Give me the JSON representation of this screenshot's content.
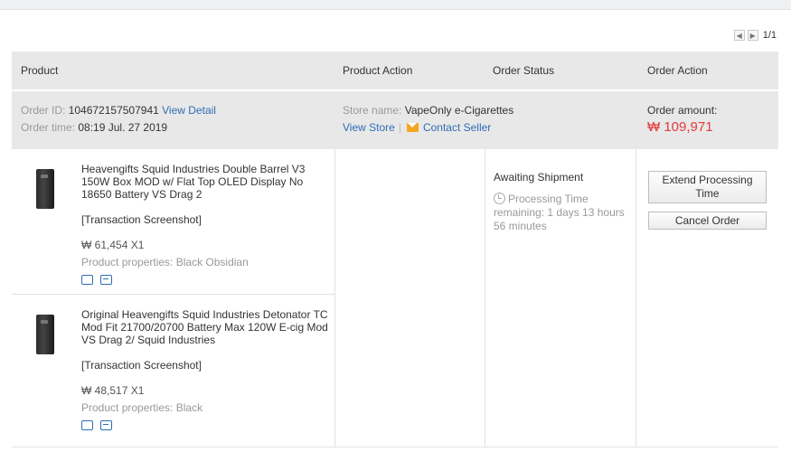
{
  "pagination": {
    "prev_icon": "chevron-left-icon",
    "next_icon": "chevron-right-icon",
    "text": "1/1"
  },
  "columns": {
    "product": "Product",
    "product_action": "Product Action",
    "order_status": "Order Status",
    "order_action": "Order Action"
  },
  "order": {
    "id_label": "Order ID:",
    "id_value": "104672157507941",
    "view_detail": "View Detail",
    "time_label": "Order time:",
    "time_value": "08:19 Jul. 27 2019",
    "store_label": "Store name:",
    "store_value": "VapeOnly e-Cigarettes",
    "view_store": "View Store",
    "separator": "|",
    "contact_seller": "Contact Seller",
    "amount_label": "Order amount:",
    "amount_value": "₩ 109,971",
    "status": "Awaiting Shipment",
    "processing_label": "Processing Time remaining: 1 days 13 hours 56 minutes",
    "extend_button": "Extend Processing Time",
    "cancel_button": "Cancel Order"
  },
  "products": [
    {
      "title": "Heavengifts Squid Industries Double Barrel V3 150W Box MOD w/ Flat Top OLED Display No 18650 Battery VS Drag 2",
      "transaction": "[Transaction Screenshot]",
      "price": "₩ 61,454 X1",
      "properties": "Product properties: Black Obsidian",
      "icons": [
        "shipping-icon",
        "receipt-icon"
      ]
    },
    {
      "title": "Original Heavengifts Squid Industries Detonator TC Mod Fit 21700/20700 Battery Max 120W E-cig Mod VS Drag 2/ Squid Industries",
      "transaction": "[Transaction Screenshot]",
      "price": "₩ 48,517 X1",
      "properties": "Product properties: Black",
      "icons": [
        "shipping-icon",
        "receipt-icon"
      ]
    }
  ],
  "colors": {
    "link": "#2f6db5",
    "amount": "#e4393c",
    "header_bg": "#e8e8e8",
    "mail_icon": "#f5a623"
  }
}
